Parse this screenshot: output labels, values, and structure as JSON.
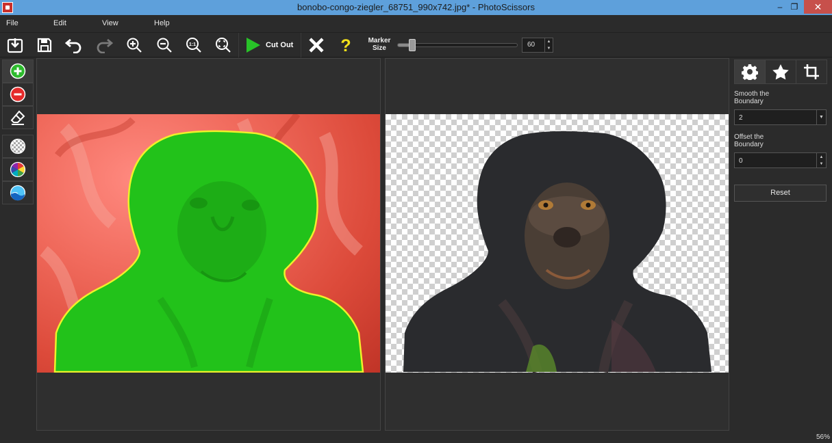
{
  "window": {
    "title": "bonobo-congo-ziegler_68751_990x742.jpg* - PhotoScissors",
    "min_glyph": "–",
    "restore_glyph": "❐",
    "close_glyph": "✕"
  },
  "menu": [
    "File",
    "Edit",
    "View",
    "Help"
  ],
  "toolbar": {
    "cutout_label": "Cut Out",
    "marker_label_line1": "Marker",
    "marker_label_line2": "Size",
    "marker_size": "60",
    "marker_fraction": 0.1
  },
  "settings": {
    "smooth_label_line1": "Smooth the",
    "smooth_label_line2": "Boundary",
    "smooth_value": "2",
    "offset_label_line1": "Offset the",
    "offset_label_line2": "Boundary",
    "offset_value": "0",
    "reset_label": "Reset"
  },
  "status": {
    "zoom": "56%"
  },
  "colors": {
    "foreground_mask": "#22c21a",
    "background_mask": "#e24c3c",
    "boundary": "#f0f02a",
    "accent": "#5ea0db"
  }
}
